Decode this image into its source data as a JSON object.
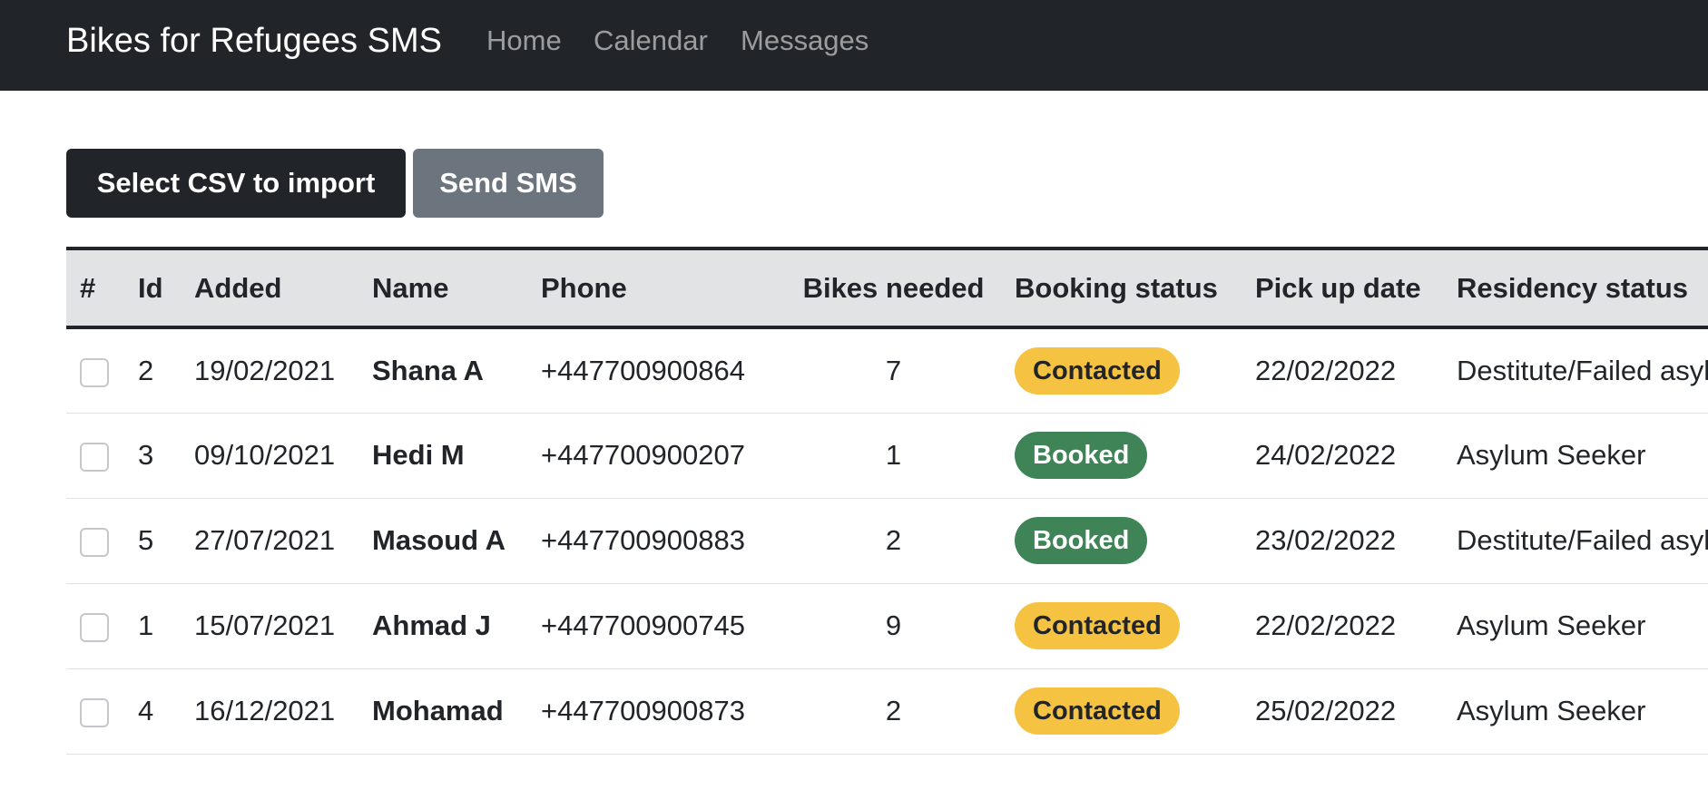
{
  "navbar": {
    "brand": "Bikes for Refugees SMS",
    "links": [
      "Home",
      "Calendar",
      "Messages"
    ]
  },
  "toolbar": {
    "import_label": "Select CSV to import",
    "send_label": "Send SMS"
  },
  "table": {
    "headers": [
      "#",
      "Id",
      "Added",
      "Name",
      "Phone",
      "Bikes needed",
      "Booking status",
      "Pick up date",
      "Residency status"
    ],
    "rows": [
      {
        "id": "2",
        "added": "19/02/2021",
        "name": "Shana A",
        "phone": "+447700900864",
        "bikes": "7",
        "status": "Contacted",
        "pickup": "22/02/2022",
        "residency": "Destitute/Failed asylum seeker"
      },
      {
        "id": "3",
        "added": "09/10/2021",
        "name": "Hedi M",
        "phone": "+447700900207",
        "bikes": "1",
        "status": "Booked",
        "pickup": "24/02/2022",
        "residency": "Asylum Seeker"
      },
      {
        "id": "5",
        "added": "27/07/2021",
        "name": "Masoud A",
        "phone": "+447700900883",
        "bikes": "2",
        "status": "Booked",
        "pickup": "23/02/2022",
        "residency": "Destitute/Failed asylum seeker"
      },
      {
        "id": "1",
        "added": "15/07/2021",
        "name": "Ahmad J",
        "phone": "+447700900745",
        "bikes": "9",
        "status": "Contacted",
        "pickup": "22/02/2022",
        "residency": "Asylum Seeker"
      },
      {
        "id": "4",
        "added": "16/12/2021",
        "name": "Mohamad",
        "phone": "+447700900873",
        "bikes": "2",
        "status": "Contacted",
        "pickup": "25/02/2022",
        "residency": "Asylum Seeker"
      }
    ]
  },
  "colors": {
    "navbar_bg": "#212529",
    "header_bg": "#e2e3e5",
    "contacted_badge": "#f5c242",
    "booked_badge": "#3e8457",
    "secondary_button": "#6c757d"
  }
}
